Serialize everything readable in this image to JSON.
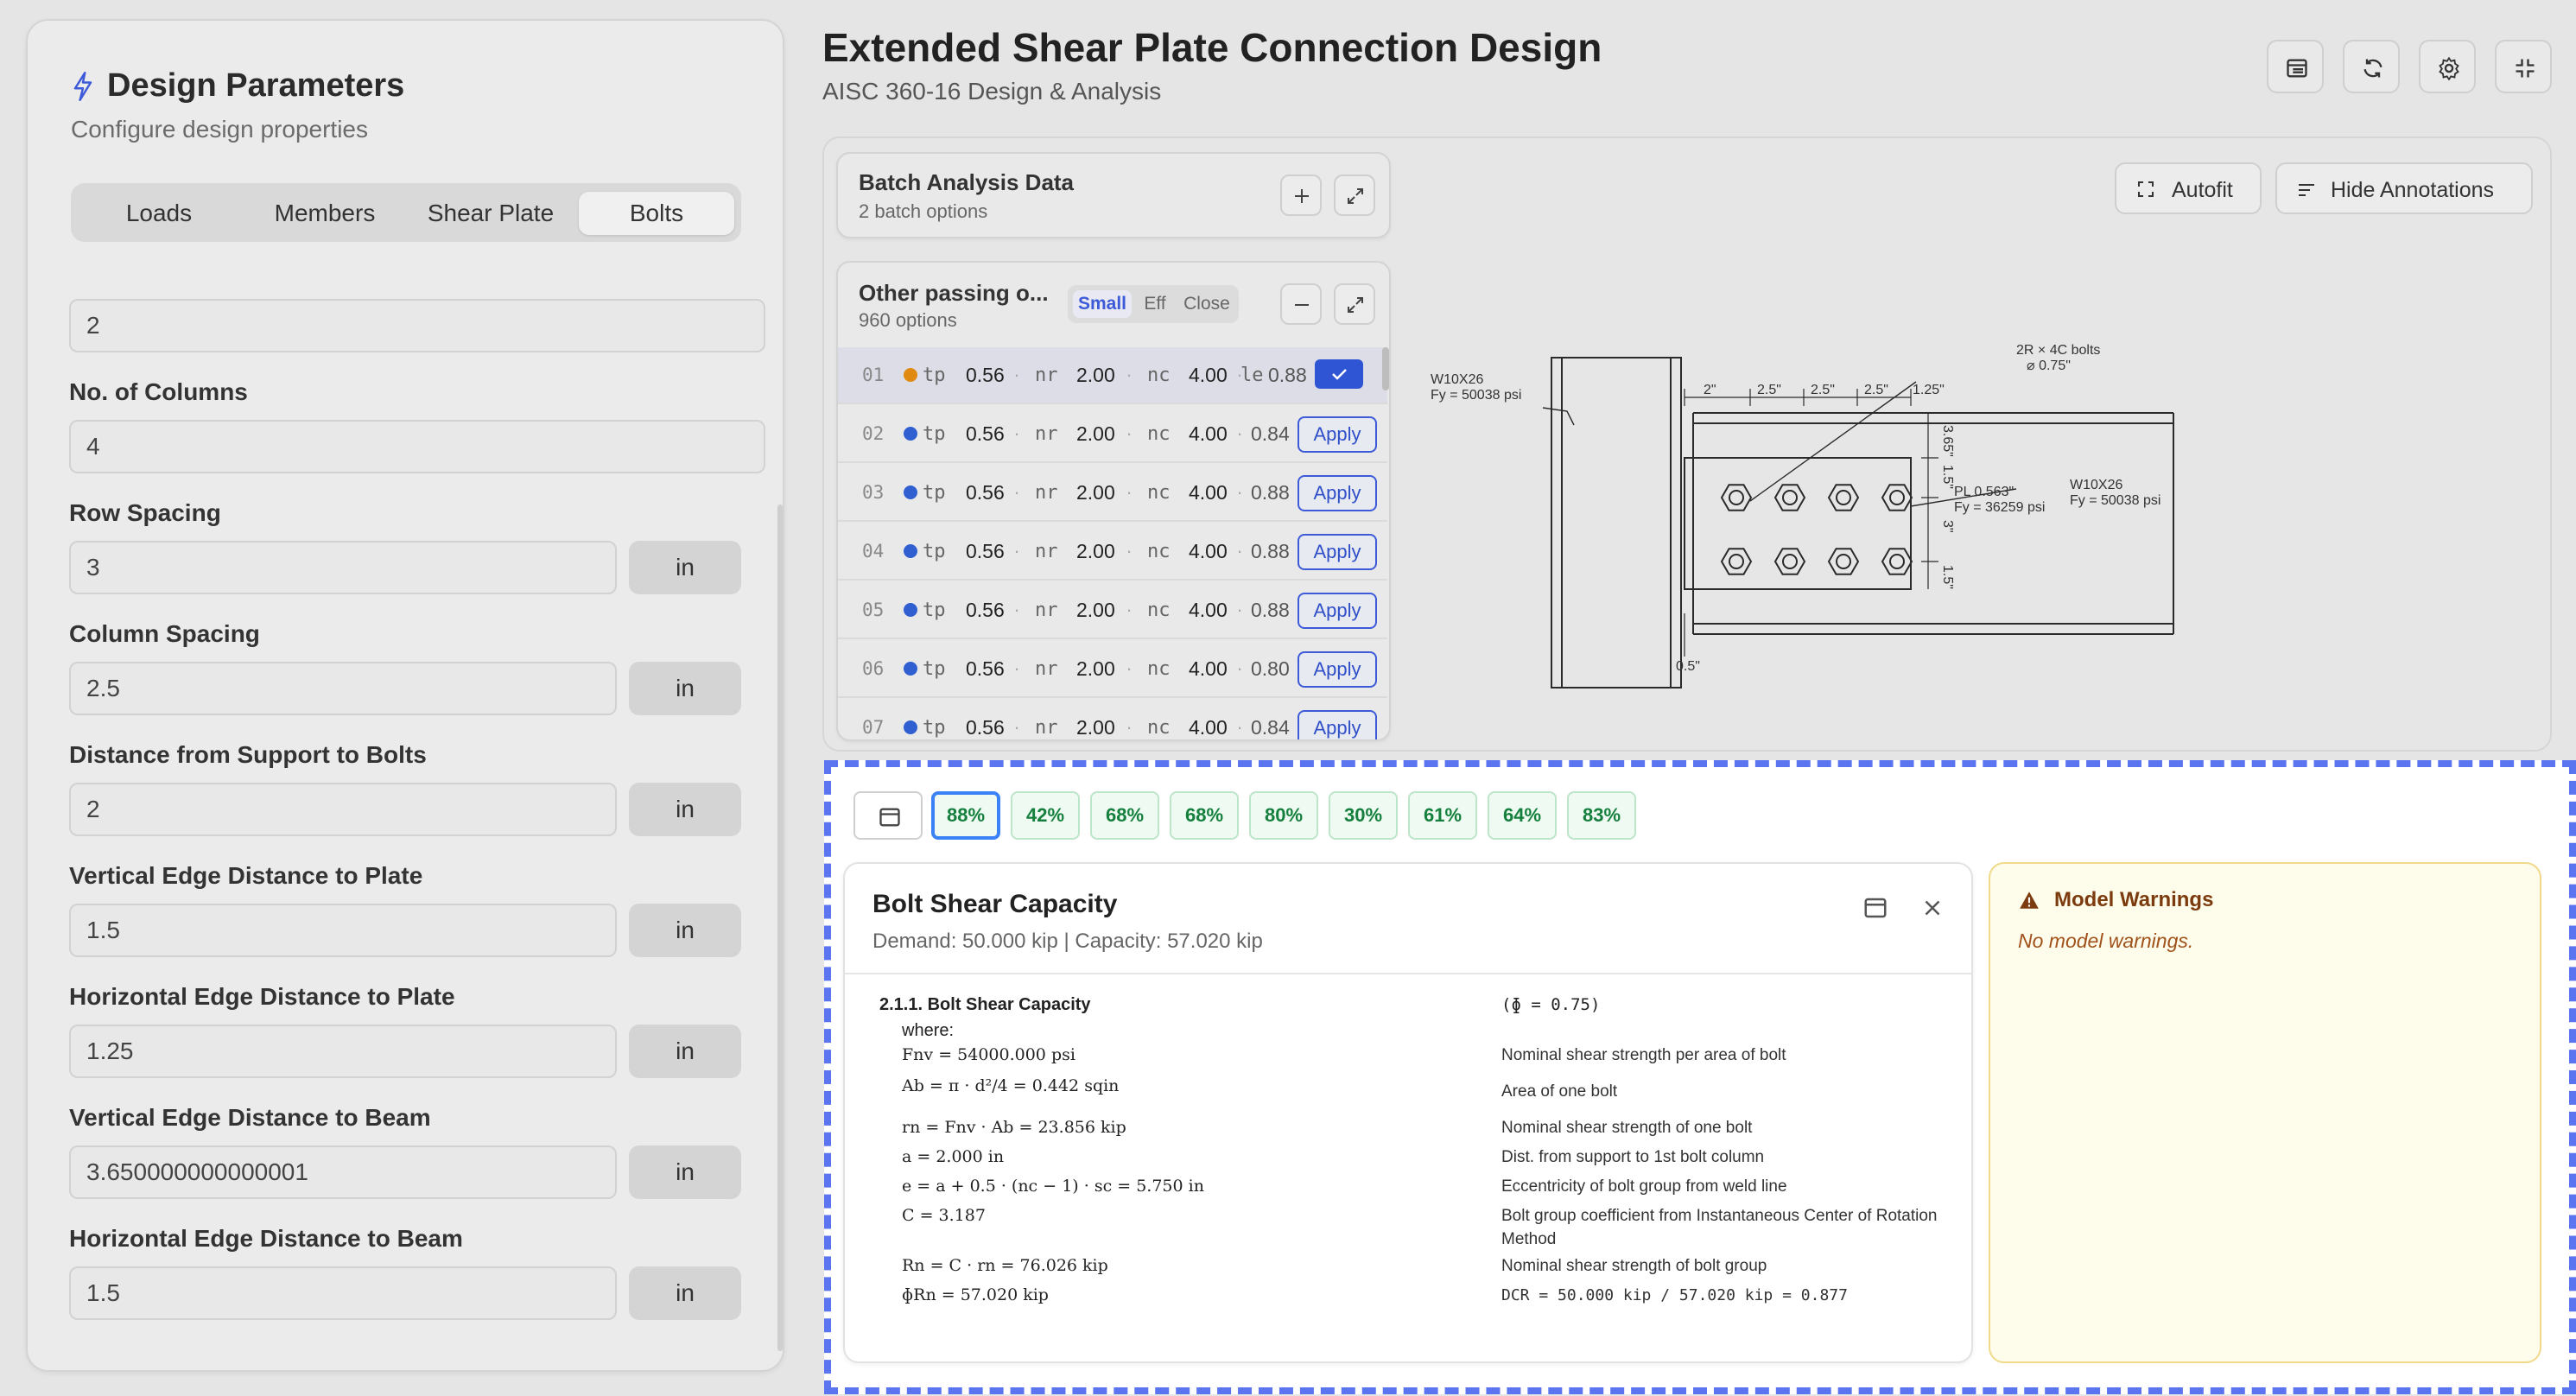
{
  "sidebar": {
    "title": "Design Parameters",
    "subtitle": "Configure design properties",
    "tabs": [
      "Loads",
      "Members",
      "Shear Plate",
      "Bolts"
    ],
    "active_tab": "Bolts",
    "fields": [
      {
        "label": "",
        "value": "2",
        "unit": ""
      },
      {
        "label": "No. of Columns",
        "value": "4",
        "unit": ""
      },
      {
        "label": "Row Spacing",
        "value": "3",
        "unit": "in"
      },
      {
        "label": "Column Spacing",
        "value": "2.5",
        "unit": "in"
      },
      {
        "label": "Distance from Support to Bolts",
        "value": "2",
        "unit": "in"
      },
      {
        "label": "Vertical Edge Distance to Plate",
        "value": "1.5",
        "unit": "in"
      },
      {
        "label": "Horizontal Edge Distance to Plate",
        "value": "1.25",
        "unit": "in"
      },
      {
        "label": "Vertical Edge Distance to Beam",
        "value": "3.650000000000001",
        "unit": "in"
      },
      {
        "label": "Horizontal Edge Distance to Beam",
        "value": "1.5",
        "unit": "in"
      }
    ]
  },
  "header": {
    "title": "Extended Shear Plate Connection Design",
    "subtitle": "AISC 360-16 Design & Analysis",
    "buttons": [
      "table-icon",
      "refresh-icon",
      "settings-icon",
      "collapse-icon"
    ]
  },
  "batch": {
    "title": "Batch Analysis Data",
    "subtitle": "2 batch options"
  },
  "options": {
    "title": "Other passing o...",
    "subtitle": "960 options",
    "filters": [
      "Small",
      "Eff",
      "Close"
    ],
    "active_filter": "Small",
    "apply_label": "Apply",
    "rows": [
      {
        "num": "01",
        "tp": "0.56",
        "nr": "2.00",
        "nc": "4.00",
        "extra_key": "le",
        "dcr": "0.88",
        "selected": true
      },
      {
        "num": "02",
        "tp": "0.56",
        "nr": "2.00",
        "nc": "4.00",
        "extra_key": "",
        "dcr": "0.84",
        "selected": false
      },
      {
        "num": "03",
        "tp": "0.56",
        "nr": "2.00",
        "nc": "4.00",
        "extra_key": "",
        "dcr": "0.88",
        "selected": false
      },
      {
        "num": "04",
        "tp": "0.56",
        "nr": "2.00",
        "nc": "4.00",
        "extra_key": "",
        "dcr": "0.88",
        "selected": false
      },
      {
        "num": "05",
        "tp": "0.56",
        "nr": "2.00",
        "nc": "4.00",
        "extra_key": "",
        "dcr": "0.88",
        "selected": false
      },
      {
        "num": "06",
        "tp": "0.56",
        "nr": "2.00",
        "nc": "4.00",
        "extra_key": "",
        "dcr": "0.80",
        "selected": false
      },
      {
        "num": "07",
        "tp": "0.56",
        "nr": "2.00",
        "nc": "4.00",
        "extra_key": "",
        "dcr": "0.84",
        "selected": false
      }
    ]
  },
  "toolbar": {
    "autofit_label": "Autofit",
    "annotations_label": "Hide Annotations"
  },
  "drawing": {
    "bolts_note": "2R × 4C bolts",
    "bolt_dia": "⌀ 0.75\"",
    "support_member": "W10X26",
    "support_fy": "Fy = 50038 psi",
    "beam_member": "W10X26",
    "beam_fy": "Fy = 50038 psi",
    "plate": "PL 0.563\"",
    "plate_fy": "Fy = 36259 psi",
    "dims_top": [
      "2\"",
      "2.5\"",
      "2.5\"",
      "2.5\"",
      "1.25\""
    ],
    "dim_right_1": "3.65\"",
    "dim_right_2": "1.5\"",
    "dim_right_3": "3\"",
    "dim_right_4": "1.5\"",
    "dim_gap": "0.5\""
  },
  "dcr_buttons": [
    "88%",
    "42%",
    "68%",
    "68%",
    "80%",
    "30%",
    "61%",
    "64%",
    "83%"
  ],
  "dcr_active_index": 0,
  "calc": {
    "title": "Bolt Shear Capacity",
    "subtitle": "Demand: 50.000 kip | Capacity: 57.020 kip",
    "section": "2.1.1. Bolt Shear Capacity",
    "phi": "(ɸ = 0.75)",
    "where": "where:",
    "lines": [
      {
        "expr": "Fnv = 54000.000 psi",
        "desc": "Nominal shear strength per area of bolt"
      },
      {
        "expr": "Ab = π · d²/4 = 0.442 sqin",
        "desc": "Area of one bolt"
      },
      {
        "expr": "rn = Fnv · Ab = 23.856 kip",
        "desc": "Nominal shear strength of one bolt"
      },
      {
        "expr": "a = 2.000 in",
        "desc": "Dist. from support to 1st bolt column"
      },
      {
        "expr": "e = a + 0.5 · (nc − 1) · sc = 5.750 in",
        "desc": "Eccentricity of bolt group from weld line"
      },
      {
        "expr": "C = 3.187",
        "desc": "Bolt group coefficient from Instantaneous Center of Rotation Method"
      },
      {
        "expr": "Rn = C · rn = 76.026 kip",
        "desc": "Nominal shear strength of bolt group"
      },
      {
        "expr": "ɸRn = 57.020 kip",
        "desc": "DCR = 50.000 kip / 57.020 kip = 0.877"
      }
    ]
  },
  "warnings": {
    "title": "Model Warnings",
    "body": "No model warnings."
  },
  "colors": {
    "accent": "#3d5ad8",
    "selection_border": "#5b74f0",
    "pass_green": "#15803d",
    "warning_brown": "#7c3b0e"
  }
}
